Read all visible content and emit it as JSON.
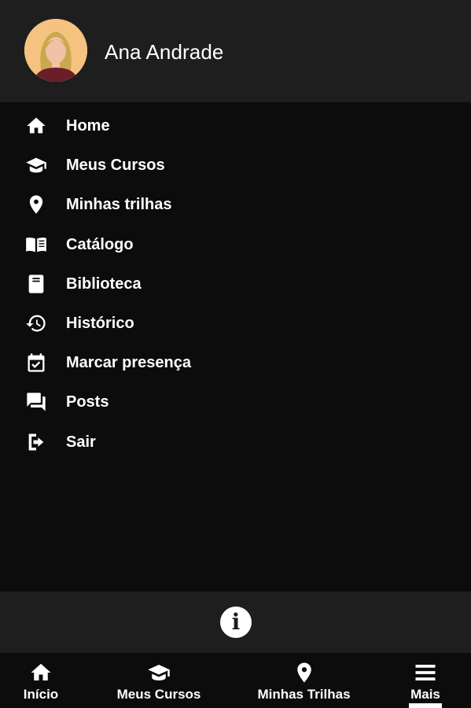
{
  "user": {
    "name": "Ana Andrade"
  },
  "menu": {
    "items": [
      {
        "label": "Home",
        "icon": "home-icon"
      },
      {
        "label": "Meus Cursos",
        "icon": "graduation-cap-icon"
      },
      {
        "label": "Minhas trilhas",
        "icon": "location-pin-icon"
      },
      {
        "label": "Catálogo",
        "icon": "open-book-icon"
      },
      {
        "label": "Biblioteca",
        "icon": "book-icon"
      },
      {
        "label": "Histórico",
        "icon": "history-icon"
      },
      {
        "label": "Marcar presença",
        "icon": "calendar-check-icon"
      },
      {
        "label": "Posts",
        "icon": "chat-bubbles-icon"
      },
      {
        "label": "Sair",
        "icon": "logout-icon"
      }
    ]
  },
  "info": {
    "icon": "info-icon",
    "glyph": "i"
  },
  "bottom_nav": {
    "items": [
      {
        "label": "Início",
        "icon": "home-icon"
      },
      {
        "label": "Meus Cursos",
        "icon": "graduation-cap-icon"
      },
      {
        "label": "Minhas Trilhas",
        "icon": "location-pin-icon"
      },
      {
        "label": "Mais",
        "icon": "menu-icon",
        "active": true
      }
    ]
  },
  "colors": {
    "background": "#0c0c0c",
    "panel": "#1e1e1e",
    "text": "#ffffff",
    "avatar_skin": "#f6c27f"
  }
}
